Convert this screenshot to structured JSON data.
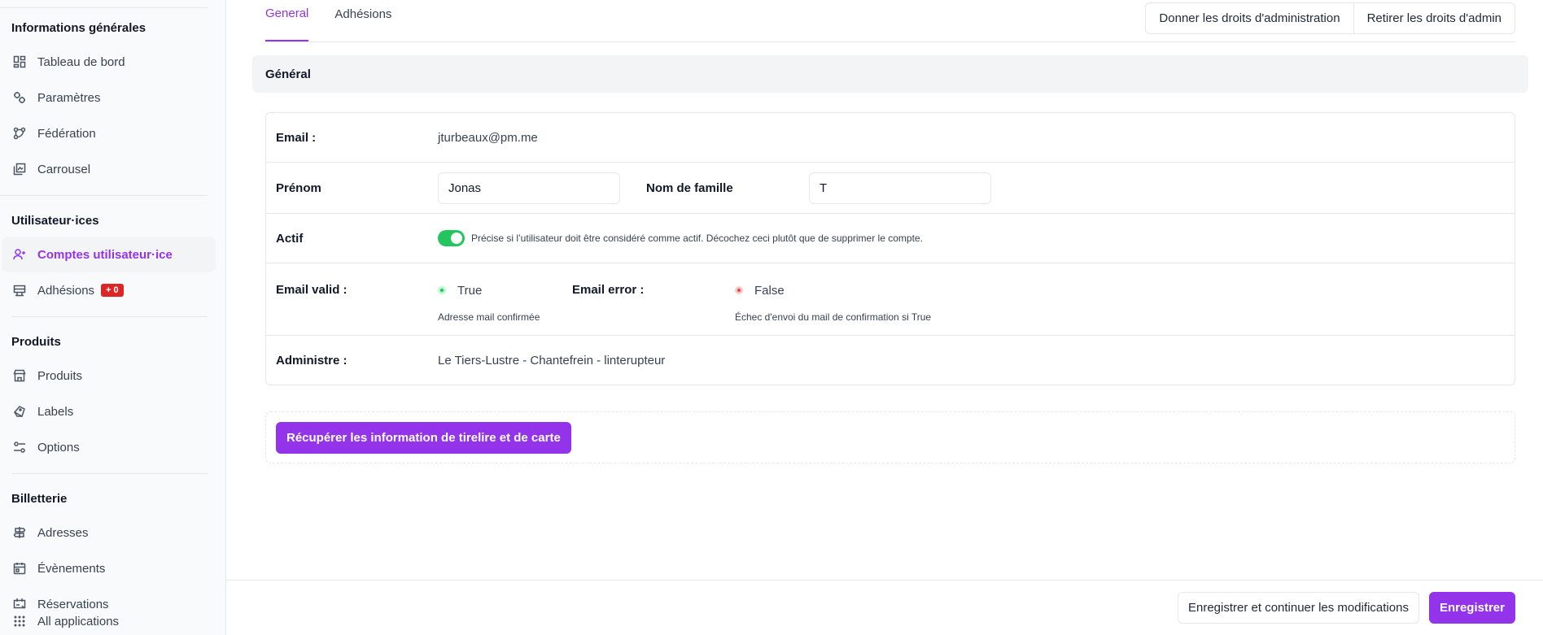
{
  "sidebar": {
    "sections": [
      {
        "heading": "Informations générales",
        "items": [
          {
            "label": "Tableau de bord",
            "icon": "dashboard-icon"
          },
          {
            "label": "Paramètres",
            "icon": "settings-icon"
          },
          {
            "label": "Fédération",
            "icon": "federation-icon"
          },
          {
            "label": "Carrousel",
            "icon": "carousel-icon"
          }
        ]
      },
      {
        "heading": "Utilisateur·ices",
        "items": [
          {
            "label": "Comptes utilisateur·ice",
            "icon": "user-add-icon",
            "active": true
          },
          {
            "label": "Adhésions",
            "icon": "membership-icon",
            "badge": "+ 0"
          }
        ]
      },
      {
        "heading": "Produits",
        "items": [
          {
            "label": "Produits",
            "icon": "store-icon"
          },
          {
            "label": "Labels",
            "icon": "tag-icon"
          },
          {
            "label": "Options",
            "icon": "options-icon"
          }
        ]
      },
      {
        "heading": "Billetterie",
        "items": [
          {
            "label": "Adresses",
            "icon": "signpost-icon"
          },
          {
            "label": "Évènements",
            "icon": "calendar-icon"
          },
          {
            "label": "Réservations",
            "icon": "reservation-icon"
          }
        ]
      }
    ],
    "all_apps": "All applications"
  },
  "tabs": [
    {
      "label": "General",
      "active": true
    },
    {
      "label": "Adhésions",
      "active": false
    }
  ],
  "admin_actions": {
    "give": "Donner les droits d'administration",
    "remove": "Retirer les droits d'admin"
  },
  "section_title": "Général",
  "form": {
    "email_label": "Email :",
    "email_value": "jturbeaux@pm.me",
    "prenom_label": "Prénom",
    "prenom_value": "Jonas",
    "nom_label": "Nom de famille",
    "nom_value": "T",
    "actif_label": "Actif",
    "actif_on": true,
    "actif_help": "Précise si l’utilisateur doit être considéré comme actif. Décochez ceci plutôt que de supprimer le compte.",
    "email_valid_label": "Email valid :",
    "email_valid_value": "True",
    "email_valid_help": "Adresse mail confirmée",
    "email_error_label": "Email error :",
    "email_error_value": "False",
    "email_error_help": "Échec d'envoi du mail de confirmation si True",
    "administre_label": "Administre :",
    "administre_value": "Le Tiers-Lustre - Chantefrein - linterupteur"
  },
  "action_button": "Récupérer les information de tirelire et de carte",
  "footer": {
    "save_continue": "Enregistrer et continuer les modifications",
    "save": "Enregistrer"
  },
  "colors": {
    "accent": "#9333ea",
    "toggle_on": "#22c55e",
    "status_false": "#ef4444",
    "badge": "#dc2626"
  }
}
